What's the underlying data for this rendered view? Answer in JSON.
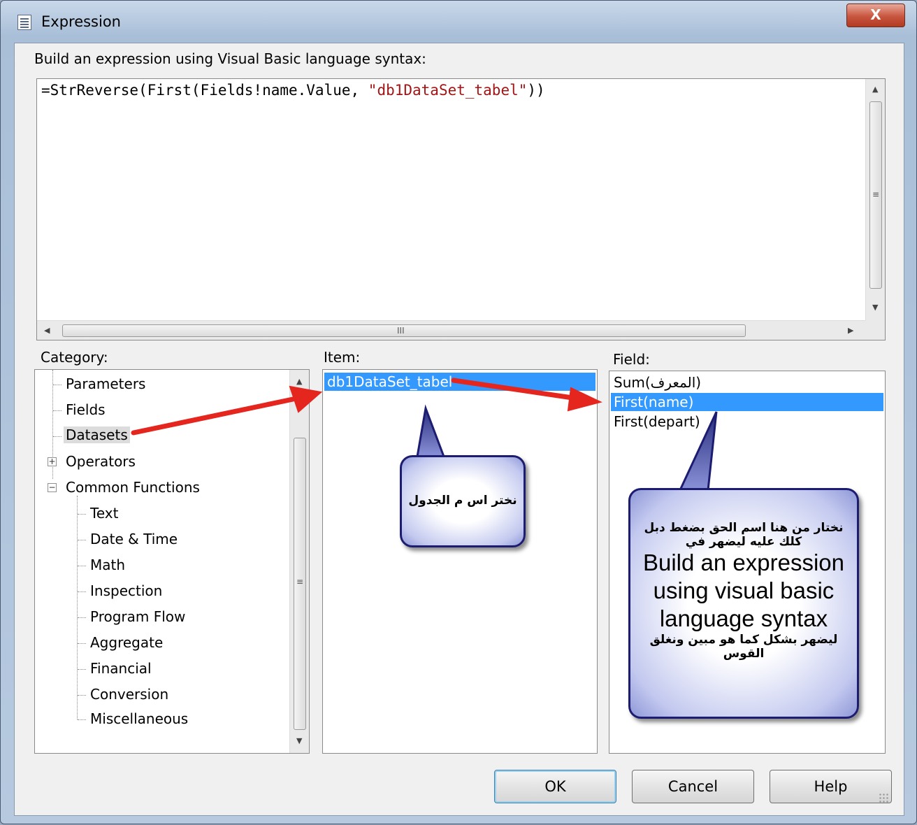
{
  "window": {
    "title": "Expression",
    "close_glyph": "X"
  },
  "prompt": "Build an expression using Visual Basic language syntax:",
  "expression": {
    "prefix": "=StrReverse(First(Fields!name.Value, ",
    "string_literal": "\"db1DataSet_tabel\"",
    "suffix": "))"
  },
  "category": {
    "label": "Category:",
    "items": [
      "Parameters",
      "Fields",
      "Datasets",
      "Operators",
      "Common Functions",
      "Text",
      "Date & Time",
      "Math",
      "Inspection",
      "Program Flow",
      "Aggregate",
      "Financial",
      "Conversion",
      "Miscellaneous"
    ],
    "selected": "Datasets"
  },
  "item": {
    "label": "Item:",
    "items": [
      "db1DataSet_tabel"
    ]
  },
  "field": {
    "label": "Field:",
    "items": [
      "Sum(المعرف)",
      "First(name)",
      "First(depart)"
    ],
    "selected": "First(name)"
  },
  "buttons": {
    "ok": "OK",
    "cancel": "Cancel",
    "help": "Help"
  },
  "annotations": {
    "callout_left": "نختر اس م الجدول",
    "callout_right_line1": "نختار من هنا اسم الحق بضغط دبل",
    "callout_right_line2": "كلك عليه ليضهر في",
    "callout_right_english": "Build an expression using visual basic language syntax",
    "callout_right_line3": "ليضهر بشكل كما هو مبين ونغلق",
    "callout_right_line4": "القوس",
    "arrow_color": "#e5261e",
    "callout_border_color": "#1c1c70"
  },
  "scroll": {
    "grip_vertical": "≡",
    "grip_horizontal": "III"
  }
}
